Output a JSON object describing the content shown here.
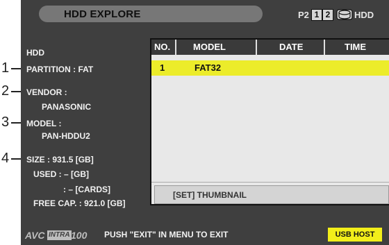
{
  "callouts": [
    "1",
    "2",
    "3",
    "4"
  ],
  "header": {
    "title": "HDD EXPLORE",
    "p2_label": "P2",
    "slots": [
      "1",
      "2"
    ],
    "hdd_label": "HDD",
    "hdd_icon": "hdd-icon"
  },
  "info": {
    "section": "HDD",
    "partition": "PARTITION : FAT",
    "vendor_label": "VENDOR :",
    "vendor_value": "PANASONIC",
    "model_label": "MODEL :",
    "model_value": "PAN-HDDU2",
    "size": "SIZE : 931.5 [GB]",
    "used_gb": "USED : – [GB]",
    "used_cards": ": – [CARDS]",
    "free_cap": "FREE CAP. : 921.0 [GB]"
  },
  "table": {
    "headers": [
      "NO.",
      "MODEL",
      "DATE",
      "TIME"
    ],
    "rows": [
      {
        "no": "1",
        "model": "FAT32",
        "date": "",
        "time": ""
      }
    ],
    "highlight_color": "#ecec2a"
  },
  "thumbnail_button": "[SET] THUMBNAIL",
  "footer": {
    "logo_avc": "AVC",
    "logo_intra": "INTRA",
    "logo_num": "100",
    "message": "PUSH \"EXIT\" IN MENU TO EXIT",
    "usb_host": "USB HOST",
    "usb_color": "#f2ee1a"
  }
}
